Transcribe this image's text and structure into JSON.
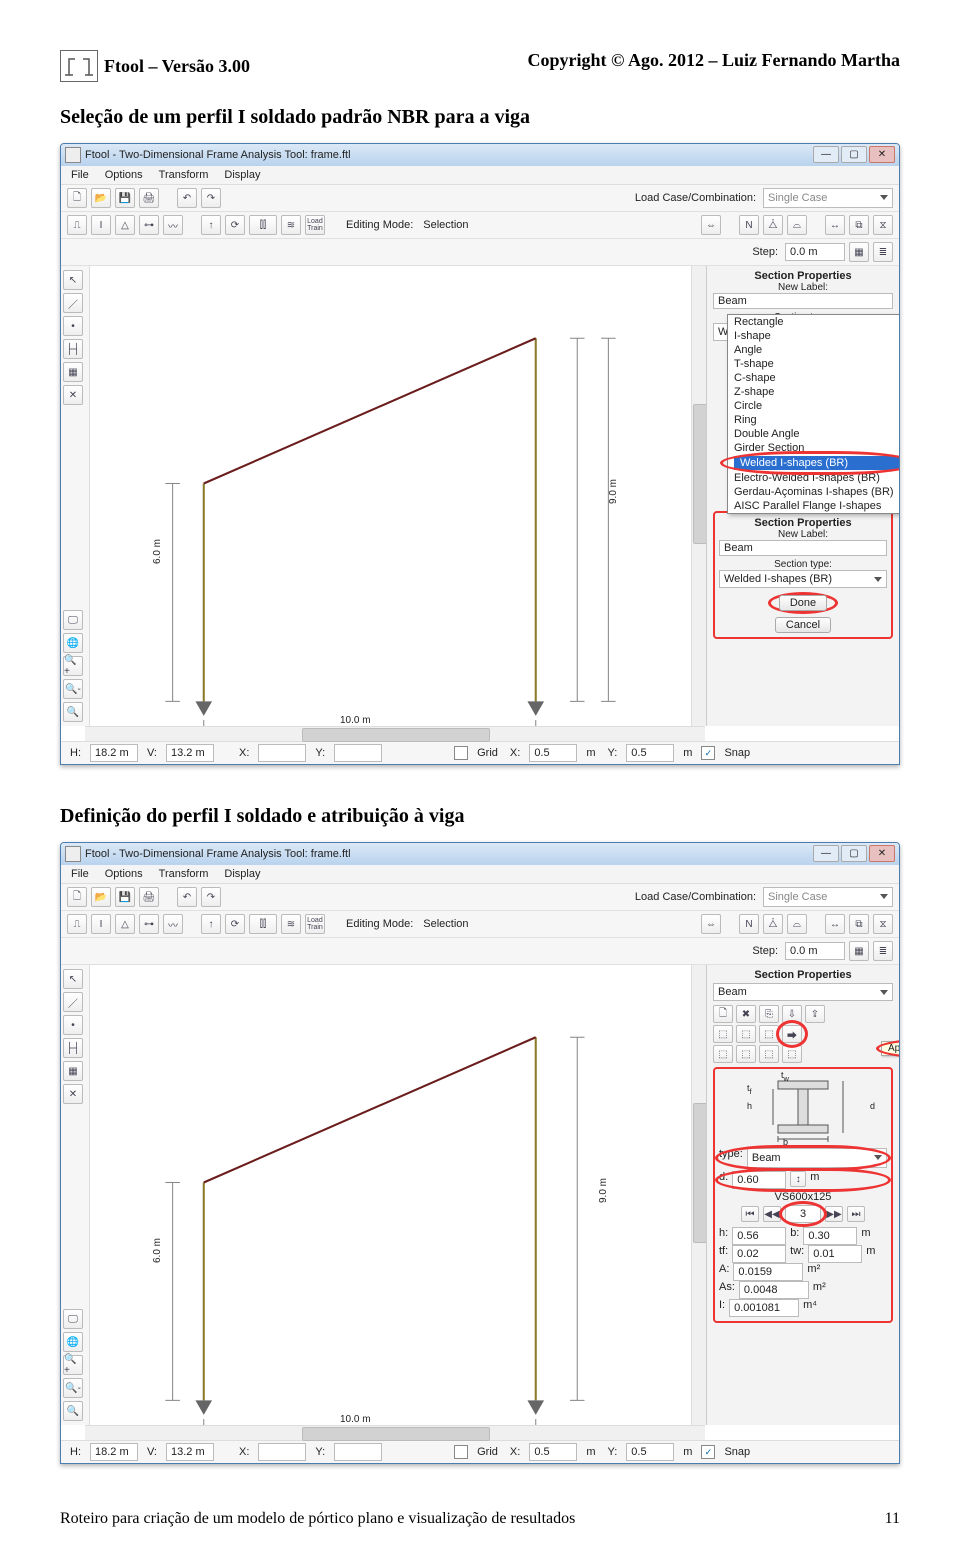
{
  "header_left": "Ftool – Versão 3.00",
  "header_right": "Copyright © Ago. 2012 – Luiz Fernando Martha",
  "heading1": "Seleção de um perfil I soldado padrão NBR para a viga",
  "heading2": "Definição do perfil I soldado e atribuição à viga",
  "footer_left": "Roteiro para criação de um modelo de pórtico plano e visualização de resultados",
  "footer_right": "11",
  "app": {
    "title": "Ftool - Two-Dimensional Frame Analysis Tool: frame.ftl",
    "menus": [
      "File",
      "Options",
      "Transform",
      "Display"
    ],
    "load_case_label": "Load Case/Combination:",
    "load_case_value": "Single Case",
    "editing_mode_label": "Editing Mode:",
    "editing_mode_value": "Selection",
    "step_label": "Step:",
    "step_value": "0.0 m",
    "status": {
      "H_lbl": "H:",
      "H": "18.2 m",
      "V_lbl": "V:",
      "V": "13.2 m",
      "X_lbl": "X:",
      "Y_lbl": "Y:",
      "grid_lbl": "Grid",
      "gx_lbl": "X:",
      "gx": "0.5",
      "gx_u": "m",
      "gy_lbl": "Y:",
      "gy": "0.5",
      "gy_u": "m",
      "snap_lbl": "Snap"
    },
    "canvas": {
      "dim_h": "10.0 m",
      "dim_v1": "6.0 m",
      "dim_v2": "9.0 m"
    }
  },
  "panel1": {
    "title": "Section Properties",
    "new_label_lbl": "New Label:",
    "new_label_value": "Beam",
    "section_type_lbl": "Section type:",
    "section_type_value": "Welded I-shapes (BR)",
    "dropdown_items": [
      "Rectangle",
      "I-shape",
      "Angle",
      "T-shape",
      "C-shape",
      "Z-shape",
      "Circle",
      "Ring",
      "Double Angle",
      "Girder Section",
      "Welded I-shapes (BR)",
      "Electro-Welded I-shapes (BR)",
      "Gerdau-Açominas I-shapes (BR)",
      "AISC Parallel Flange I-shapes"
    ],
    "done": "Done",
    "cancel": "Cancel"
  },
  "panel2": {
    "title": "Section Properties",
    "beam_label": "Beam",
    "tooltip": "Apply current section to selected members",
    "diag": {
      "tw": "t",
      "tf": "t",
      "h": "h",
      "d": "d",
      "b": "b",
      "w": "w",
      "f": "f"
    },
    "type_lbl": "type:",
    "type_value": "Beam",
    "d_lbl": "d:",
    "d_value": "0.60",
    "d_unit": "m",
    "profile_name": "VS600x125",
    "profile_index": "3",
    "h_lbl": "h:",
    "h": "0.56",
    "b_lbl": "b:",
    "b": "0.30",
    "unit_m": "m",
    "tf_lbl": "tf:",
    "tf": "0.02",
    "tw_lbl": "tw:",
    "tw": "0.01",
    "A_lbl": "A:",
    "A": "0.0159",
    "A_u": "m²",
    "As_lbl": "As:",
    "As": "0.0048",
    "As_u": "m²",
    "I_lbl": "I:",
    "I": "0.001081",
    "I_u": "m⁴"
  }
}
